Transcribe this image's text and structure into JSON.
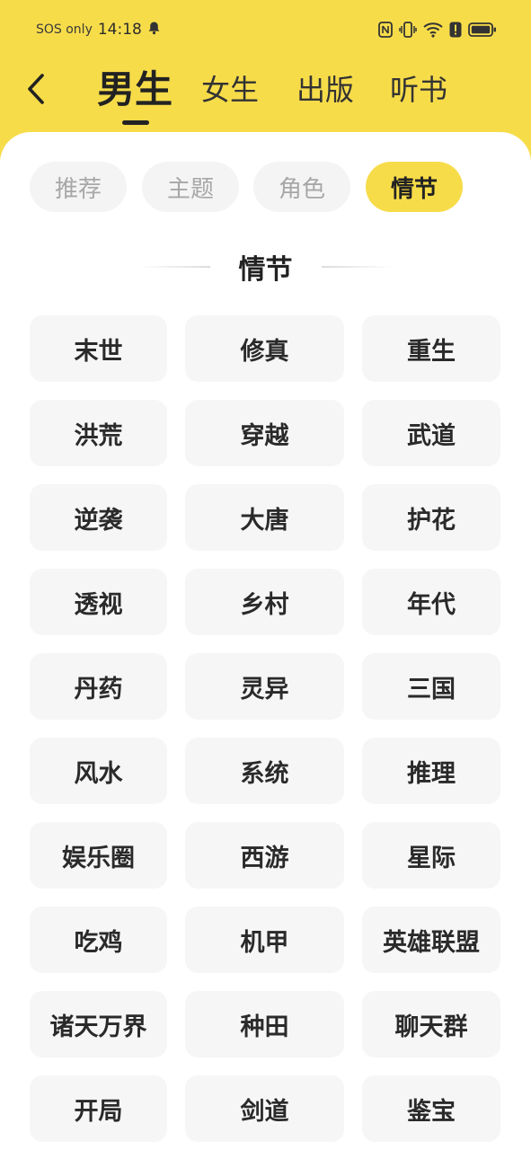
{
  "status_bar": {
    "carrier": "SOS only",
    "time": "14:18",
    "icons": [
      "bell-icon",
      "nfc-icon",
      "vibrate-icon",
      "wifi-icon",
      "alert-icon",
      "battery-icon"
    ]
  },
  "nav": {
    "back_icon": "chevron-left-icon",
    "tabs": [
      {
        "label": "男生",
        "active": true
      },
      {
        "label": "女生",
        "active": false
      },
      {
        "label": "出版",
        "active": false
      },
      {
        "label": "听书",
        "active": false
      }
    ]
  },
  "filters": {
    "chips": [
      {
        "label": "推荐",
        "active": false
      },
      {
        "label": "主题",
        "active": false
      },
      {
        "label": "角色",
        "active": false
      },
      {
        "label": "情节",
        "active": true
      }
    ]
  },
  "section": {
    "title": "情节"
  },
  "tags": [
    "末世",
    "修真",
    "重生",
    "洪荒",
    "穿越",
    "武道",
    "逆袭",
    "大唐",
    "护花",
    "透视",
    "乡村",
    "年代",
    "丹药",
    "灵异",
    "三国",
    "风水",
    "系统",
    "推理",
    "娱乐圈",
    "西游",
    "星际",
    "吃鸡",
    "机甲",
    "英雄联盟",
    "诸天万界",
    "种田",
    "聊天群",
    "开局",
    "剑道",
    "鉴宝"
  ],
  "colors": {
    "accent": "#f7dc4a",
    "chip_bg": "#f4f4f4",
    "tag_bg": "#f6f6f6",
    "text_dark": "#222222",
    "text_muted": "#a7a7a7"
  }
}
